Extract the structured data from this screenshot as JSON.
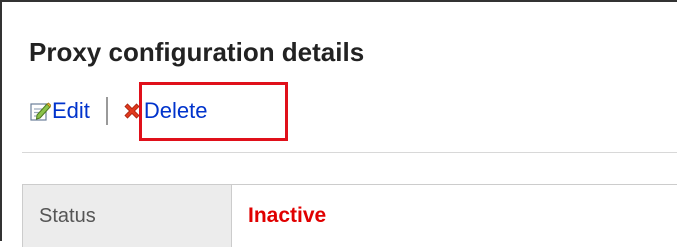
{
  "page": {
    "title": "Proxy configuration details"
  },
  "toolbar": {
    "edit_label": "Edit",
    "edit_icon": "edit-icon",
    "delete_label": "Delete",
    "delete_icon": "delete-x-icon"
  },
  "details": {
    "rows": [
      {
        "label": "Status",
        "value": "Inactive"
      }
    ]
  },
  "colors": {
    "link": "#0033cc",
    "status_inactive": "#e00000",
    "highlight": "#e0101a",
    "label_bg": "#ececec"
  }
}
